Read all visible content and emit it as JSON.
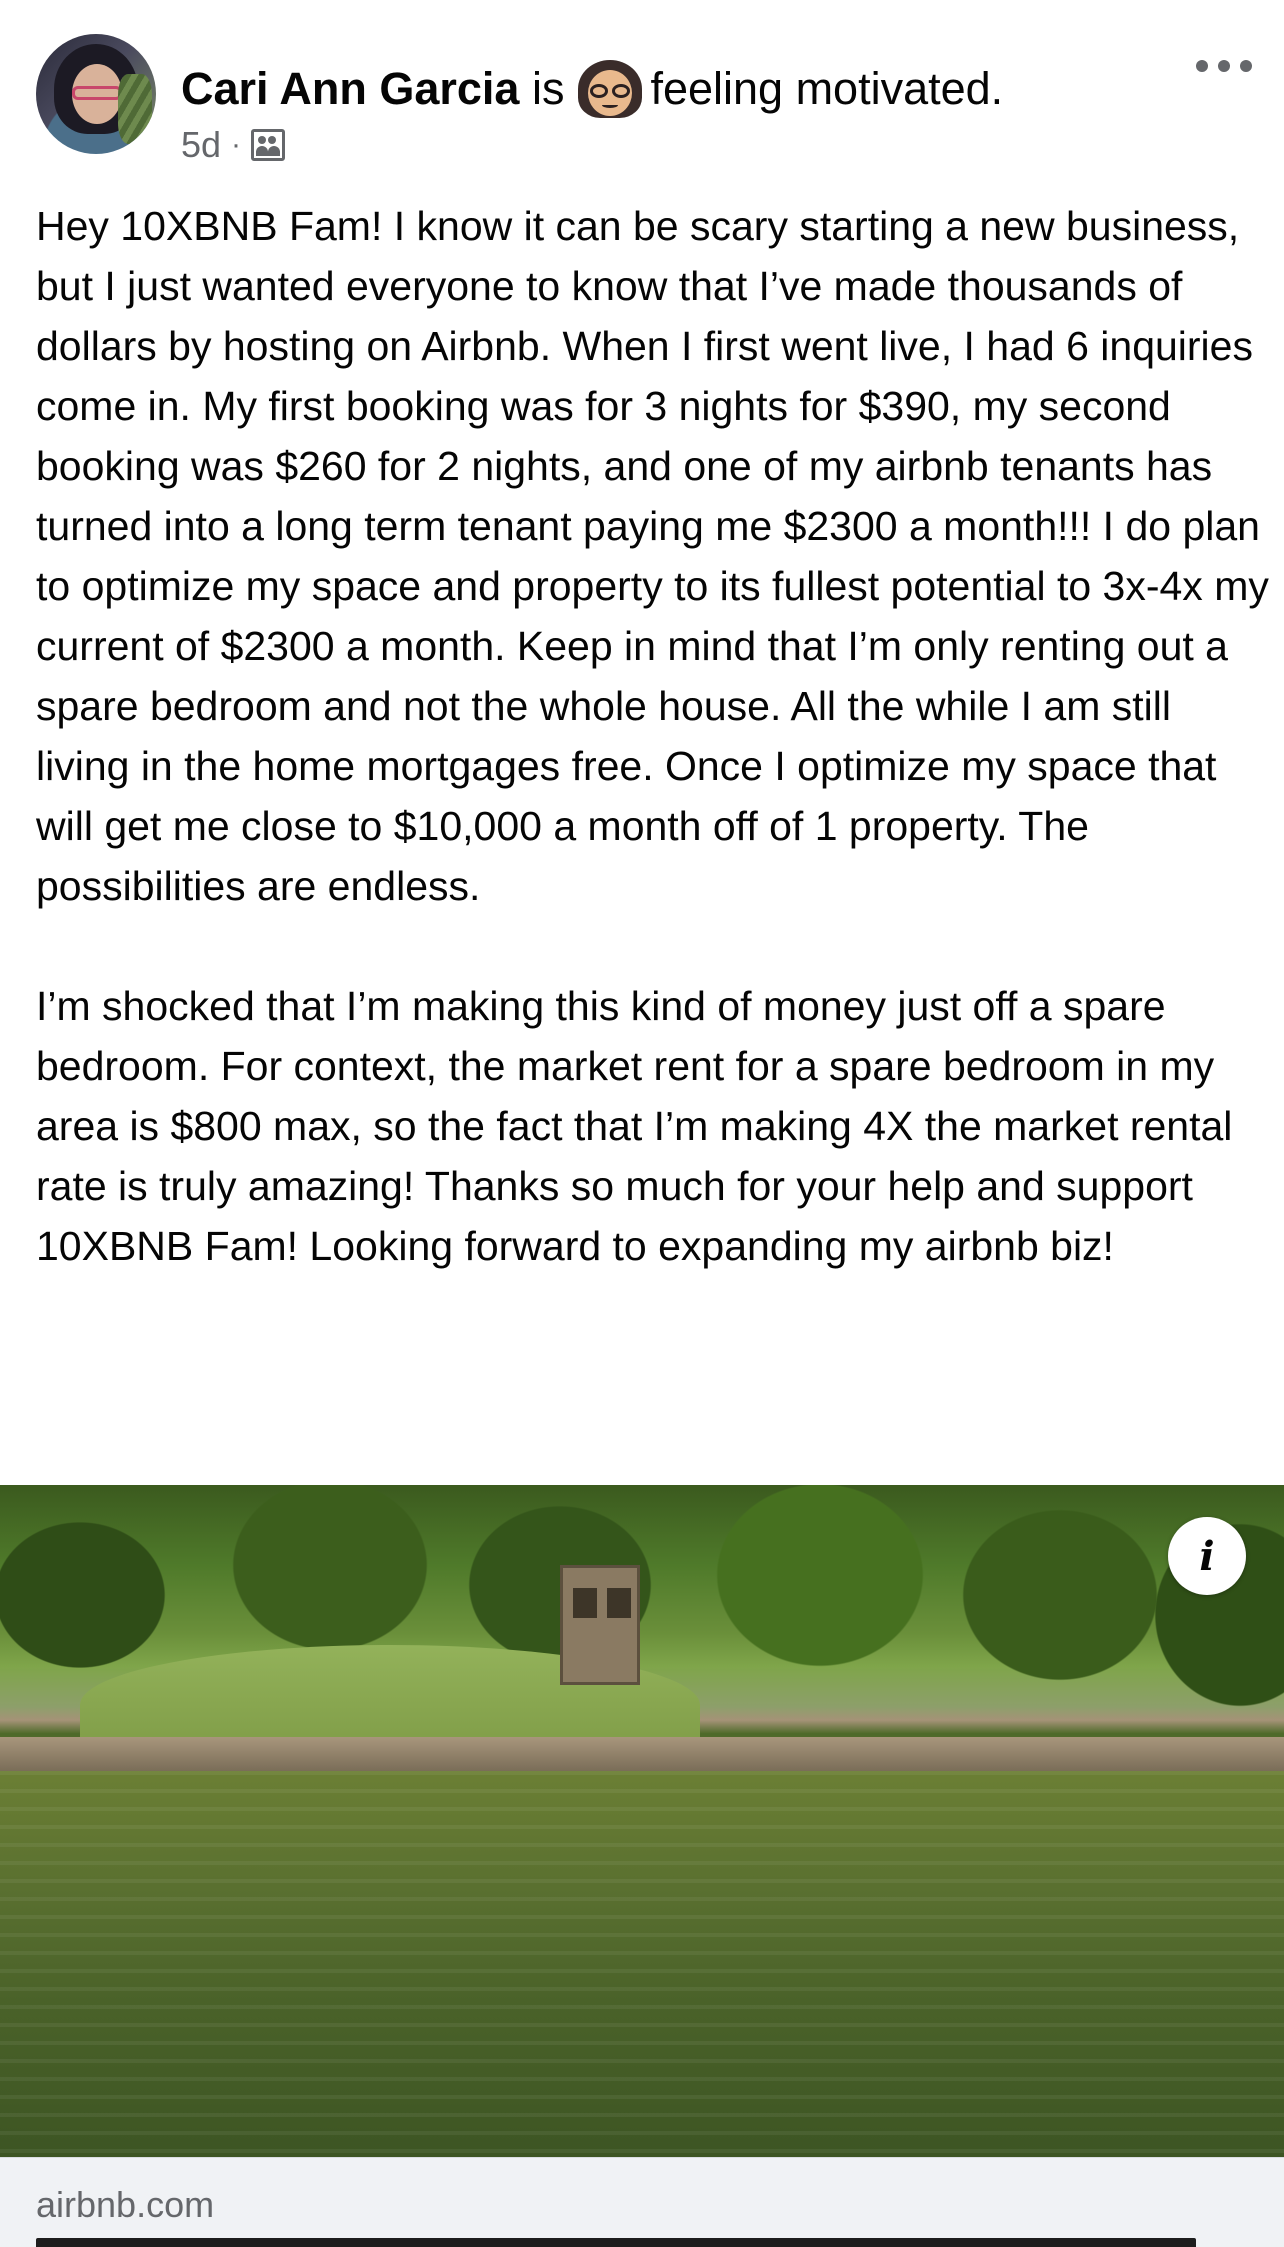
{
  "post": {
    "author": "Cari Ann Garcia",
    "is_word": "is",
    "activity": "feeling motivated.",
    "feeling_emoji": "nerd-girl-with-glasses-emoji",
    "time_ago": "5d",
    "separator": "·",
    "audience_icon": "group-members-icon",
    "more_icon": "more-options-icon",
    "paragraphs": [
      "Hey 10XBNB Fam! I know it can be scary starting a new business, but I just wanted everyone to know that I’ve made thousands of dollars by hosting on Airbnb. When I first went live, I had 6 inquiries come in. My first booking was for 3 nights for $390, my second booking was $260 for 2 nights, and one of my airbnb tenants has turned into a long term tenant paying me $2300 a month!!! I do plan to optimize my space and property to its fullest potential to 3x-4x my current of $2300 a month. Keep in mind that I’m only renting out a spare bedroom and not the whole house. All the while I am still living in the home mortgages free. Once I optimize my space that will get me close to $10,000 a month off of 1 property. The possibilities are endless.",
      "I’m shocked that I’m making this kind of money just off a spare bedroom. For context, the market rent for a spare bedroom in my area is $800 max, so the fact that I’m making 4X the market rental rate is truly amazing! Thanks so much for your help and support 10XBNB Fam! Looking forward to expanding my airbnb biz!"
    ]
  },
  "link_preview": {
    "image_description_icon": "info-icon",
    "info_label": "i",
    "domain": "airbnb.com"
  },
  "colors": {
    "text_primary": "#050505",
    "text_secondary": "#65676b",
    "footer_background": "#f0f2f5"
  }
}
